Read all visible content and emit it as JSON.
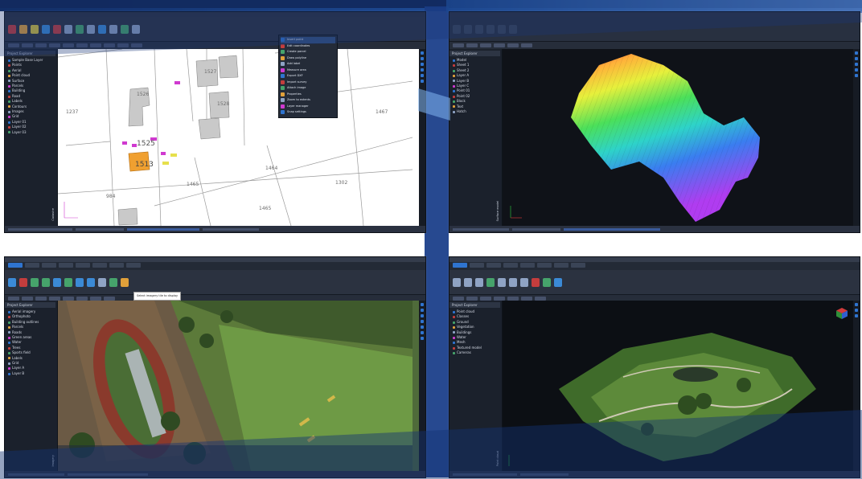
{
  "screens": {
    "cad": {
      "tree_header": "Project Explorer",
      "tree_items": [
        "Sample Base Layer",
        "Points",
        "Aerial",
        "Point cloud",
        "Surface",
        "Parcels",
        "Building",
        "Road",
        "Labels",
        "Contours",
        "Images",
        "Grid",
        "Layer 01",
        "Layer 02",
        "Layer 03"
      ],
      "tree_items2": [
        "Model",
        "Sheet 1",
        "Sheet 2",
        "Layer A",
        "Layer B",
        "Layer C",
        "Point 01",
        "Point 02",
        "Block",
        "Text",
        "Hatch"
      ],
      "parcel_labels": [
        "1237",
        "1525",
        "1526",
        "1527",
        "1528",
        "1513",
        "1467",
        "1302",
        "1465",
        "1464",
        "1465",
        "984"
      ],
      "menu_items": [
        "Insert point",
        "Edit coordinates",
        "Create parcel",
        "Draw polyline",
        "Add label",
        "Measure area",
        "Export DXF",
        "Import survey",
        "Attach image",
        "Properties",
        "Zoom to extents",
        "Layer manager",
        "Snap settings"
      ],
      "side_label": "Cadastre"
    },
    "terrain": {
      "side_label": "Surface model"
    },
    "aerial": {
      "tree_header": "Project Explorer",
      "tree_items": [
        "Aerial imagery",
        "Orthophoto",
        "Building outlines",
        "Parcels",
        "Roads",
        "Green areas",
        "Water",
        "Trees",
        "Sports field",
        "Labels",
        "Grid",
        "Layer A",
        "Layer B"
      ],
      "tooltip": "Select imagery tile to display",
      "side_label": "Imagery"
    },
    "cloud": {
      "tree_header": "Project Explorer",
      "tree_items": [
        "Point cloud",
        "Classes",
        "Ground",
        "Vegetation",
        "Buildings",
        "Water",
        "Mesh",
        "Textured model",
        "Cameras"
      ],
      "side_label": "Point cloud"
    }
  }
}
